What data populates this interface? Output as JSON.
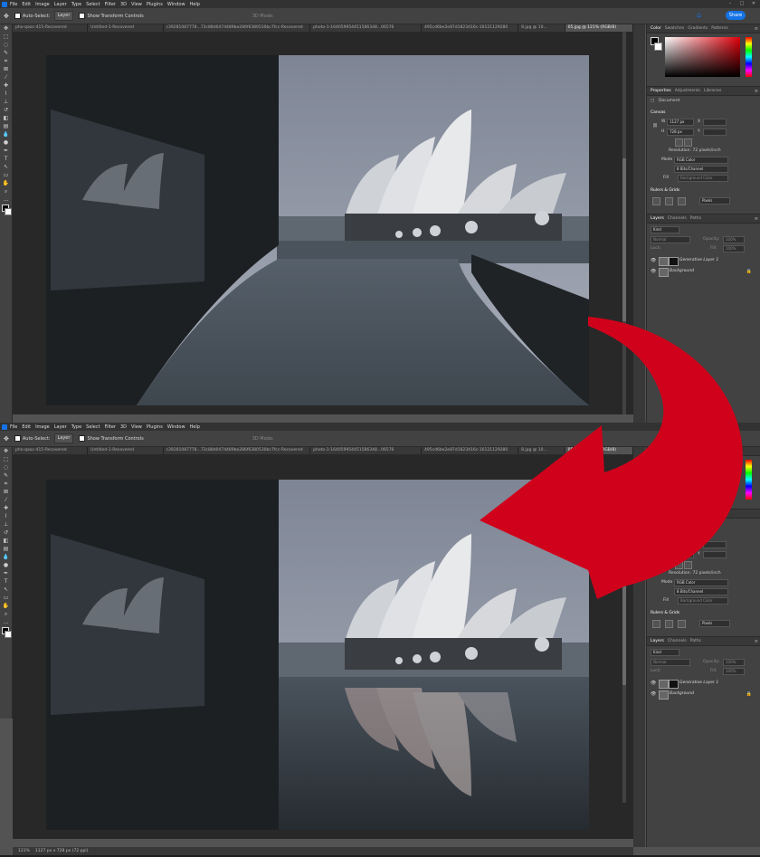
{
  "menu": [
    "File",
    "Edit",
    "Image",
    "Layer",
    "Type",
    "Select",
    "Filter",
    "3D",
    "View",
    "Plugins",
    "Window",
    "Help"
  ],
  "options_bar": {
    "auto_select": "Auto-Select:",
    "layer_dropdown": "Layer",
    "transform_label": "Show Transform Controls",
    "mode_3d": "3D Mode:",
    "share": "Share"
  },
  "tabs": [
    "pho-qaoc-415-Recovered",
    "Untitled-1-Recovered",
    "c39281087778...73c88d0474489be286f6380530bc7fcc-Recovered",
    "photo-1-164059954451586348...06576",
    "495cd6be2e87d1823416c-16121129280",
    "8.jpg @ 10...",
    "05.jpg @ 121% (RGB/8)"
  ],
  "panels": {
    "color_tabs": [
      "Color",
      "Swatches",
      "Gradients",
      "Patterns"
    ],
    "props_tabs": [
      "Properties",
      "Adjustments",
      "Libraries"
    ],
    "doc_label": "Document",
    "canvas": {
      "title": "Canvas",
      "w_label": "W",
      "w_value": "1127 px",
      "h_label": "H",
      "h_value": "728 px",
      "x_label": "X",
      "y_label": "Y",
      "resolution": "Resolution: 72 pixels/inch",
      "mode_label": "Mode",
      "mode_value": "RGB Color",
      "depth_value": "8 Bits/Channel",
      "fill_label": "Fill",
      "fill_value": "Background Color"
    },
    "rulers": {
      "title": "Rulers & Grids",
      "unit": "Pixels"
    },
    "layers_tabs": [
      "Layers",
      "Channels",
      "Paths"
    ],
    "kind": "Kind",
    "blend": "Normal",
    "opacity_label": "Opacity:",
    "opacity_value": "100%",
    "lock_label": "Lock:",
    "fill_label": "Fill:",
    "fill_value": "100%",
    "layers": [
      {
        "name": "Generative Layer 1"
      },
      {
        "name": "Background"
      }
    ]
  },
  "status": {
    "zoom": "121%",
    "doc": "1127 px x 728 px (72 ppi)"
  },
  "colors": {
    "accent": "#1473e6",
    "arrow": "#d0021b",
    "ui_bg": "#535353",
    "panel_bg": "#424242",
    "menubar": "#323232"
  }
}
